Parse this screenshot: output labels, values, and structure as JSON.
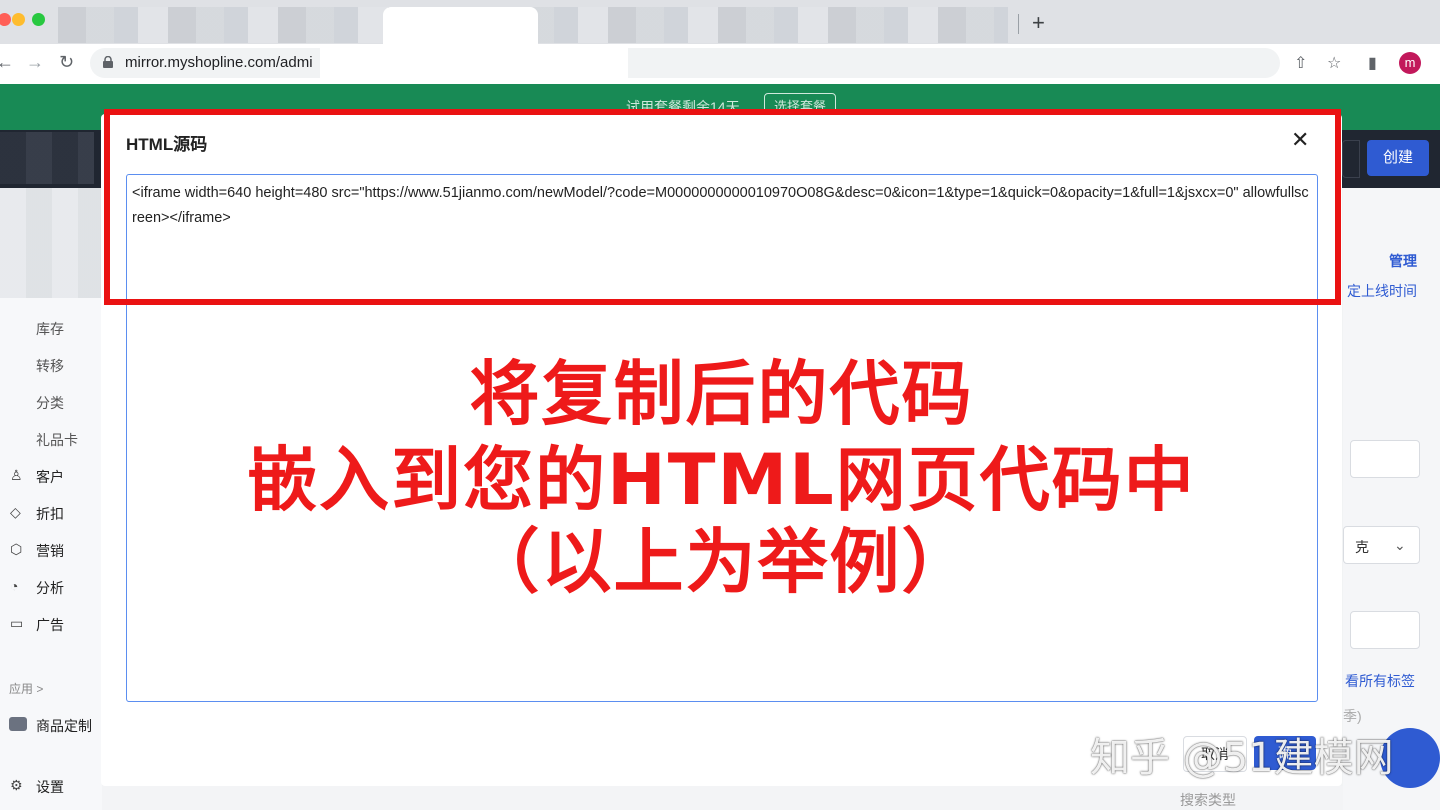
{
  "browser": {
    "url": "mirror.myshopline.com/admi",
    "profile_initial": "m",
    "new_tab_icon": "plus-icon"
  },
  "banner": {
    "text": "试用套餐剩余14天",
    "button": "选择套餐"
  },
  "header": {
    "create_button": "创建"
  },
  "sidebar": {
    "items": [
      {
        "label": "库存"
      },
      {
        "label": "转移"
      },
      {
        "label": "分类"
      },
      {
        "label": "礼品卡"
      },
      {
        "label": "客户",
        "icon": "user-icon"
      },
      {
        "label": "折扣",
        "icon": "tag-icon"
      },
      {
        "label": "营销",
        "icon": "cube-icon"
      },
      {
        "label": "分析",
        "icon": "chart-icon"
      },
      {
        "label": "广告",
        "icon": "monitor-icon"
      }
    ],
    "section_label": "应用 >",
    "app_item": "商品定制",
    "settings": "设置"
  },
  "right_pane": {
    "manage": "管理",
    "schedule": "定上线时间",
    "select_value": "克",
    "view_all_tags": "看所有标签",
    "season_hint": "季)",
    "search_type": "搜索类型"
  },
  "modal": {
    "title": "HTML源码",
    "code": "<iframe width=640 height=480 src=\"https://www.51jianmo.com/newModel/?code=M0000000000010970O08G&desc=0&icon=1&type=1&quick=0&opacity=1&full=1&jsxcx=0\" allowfullscreen></iframe>",
    "cancel": "取消",
    "ok": "确"
  },
  "annotation": {
    "line1": "将复制后的代码",
    "line2": "嵌入到您的HTML网页代码中",
    "line3": "（以上为举例）",
    "color": "#ee1a1a"
  },
  "watermark": "知乎 @51建模网",
  "colors": {
    "banner_green": "#188a55",
    "primary_blue": "#2f5bd2",
    "highlight_red": "#ea1212"
  }
}
